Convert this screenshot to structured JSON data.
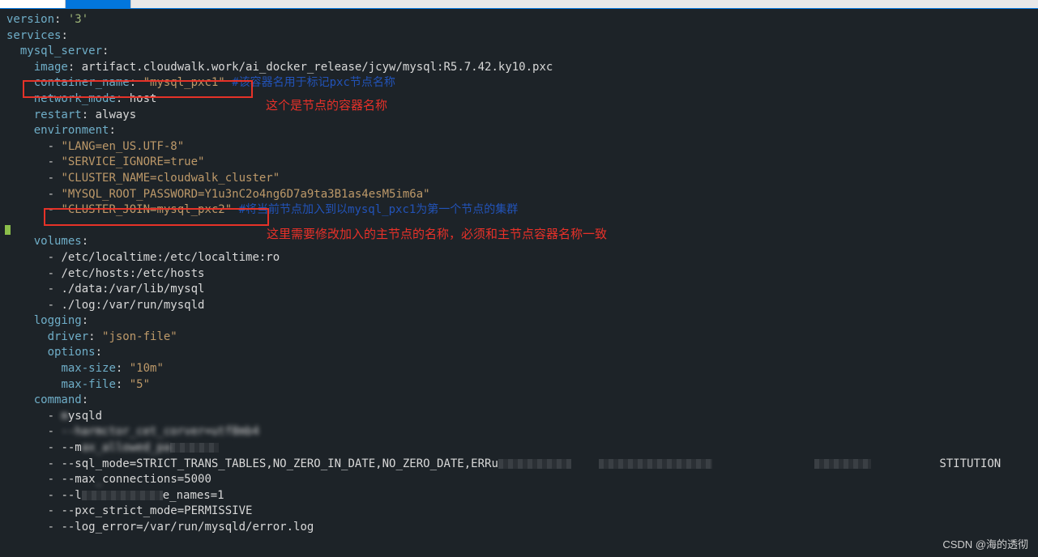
{
  "tabs": {
    "t1": "",
    "t2": ""
  },
  "code": {
    "l1_key": "version",
    "l1_val": "'3'",
    "l2_key": "services",
    "l3_key": "mysql_server",
    "l4_key": "image",
    "l4_val": "artifact.cloudwalk.work/ai_docker_release/jcyw/mysql:R5.7.42.ky10.pxc",
    "l5_key": "container_name",
    "l5_val": "\"mysql_pxc1\"",
    "l5_comment": "#该容器名用于标记pxc节点名称",
    "l6_key": "network_mode",
    "l6_val": "host",
    "l7_key": "restart",
    "l7_val": "always",
    "l8_key": "environment",
    "env1": "\"LANG=en_US.UTF-8\"",
    "env2": "\"SERVICE_IGNORE=true\"",
    "env3": "\"CLUSTER_NAME=cloudwalk_cluster\"",
    "env4": "\"MYSQL_ROOT_PASSWORD=Y1u3nC2o4ng6D7a9ta3B1as4esM5im6a\"",
    "env5": "\"CLUSTER_JOIN=mysql_pxc2\"",
    "env5_comment": "#将当前节点加入到以mysql_pxc1为第一个节点的集群",
    "l9_key": "volumes",
    "vol1": "/etc/localtime:/etc/localtime:ro",
    "vol2": "/etc/hosts:/etc/hosts",
    "vol3": "./data:/var/lib/mysql",
    "vol4": "./log:/var/run/mysqld",
    "l10_key": "logging",
    "l11_key": "driver",
    "l11_val": "\"json-file\"",
    "l12_key": "options",
    "l13_key": "max-size",
    "l13_val": "\"10m\"",
    "l14_key": "max-file",
    "l14_val": "\"5\"",
    "l15_key": "command",
    "cmd1a": "m",
    "cmd1b": "ysqld",
    "cmd2a": "--",
    "cmd2b": "harmctor_cet_corver=utf8mb4",
    "cmd3a": "--m",
    "cmd3b": "ax_allowed_pa",
    "cmd4a": "--sql_mode=STRICT_TRANS_TABLES,NO_ZERO_IN_DATE,NO_ZERO_DATE,ERRu",
    "cmd4b": "STITUTION",
    "cmd5a": "--max",
    "cmd5b": "connections=5000",
    "cmd6a": "--l",
    "cmd6b": "e_names=1",
    "cmd7": "--pxc_strict_mode=PERMISSIVE",
    "cmd8": "--log_error=/var/run/mysqld/error.log"
  },
  "annotations": {
    "a1": "这个是节点的容器名称",
    "a2": "这里需要修改加入的主节点的名称，必须和主节点容器名称一致"
  },
  "watermark": "CSDN @海的透彻"
}
